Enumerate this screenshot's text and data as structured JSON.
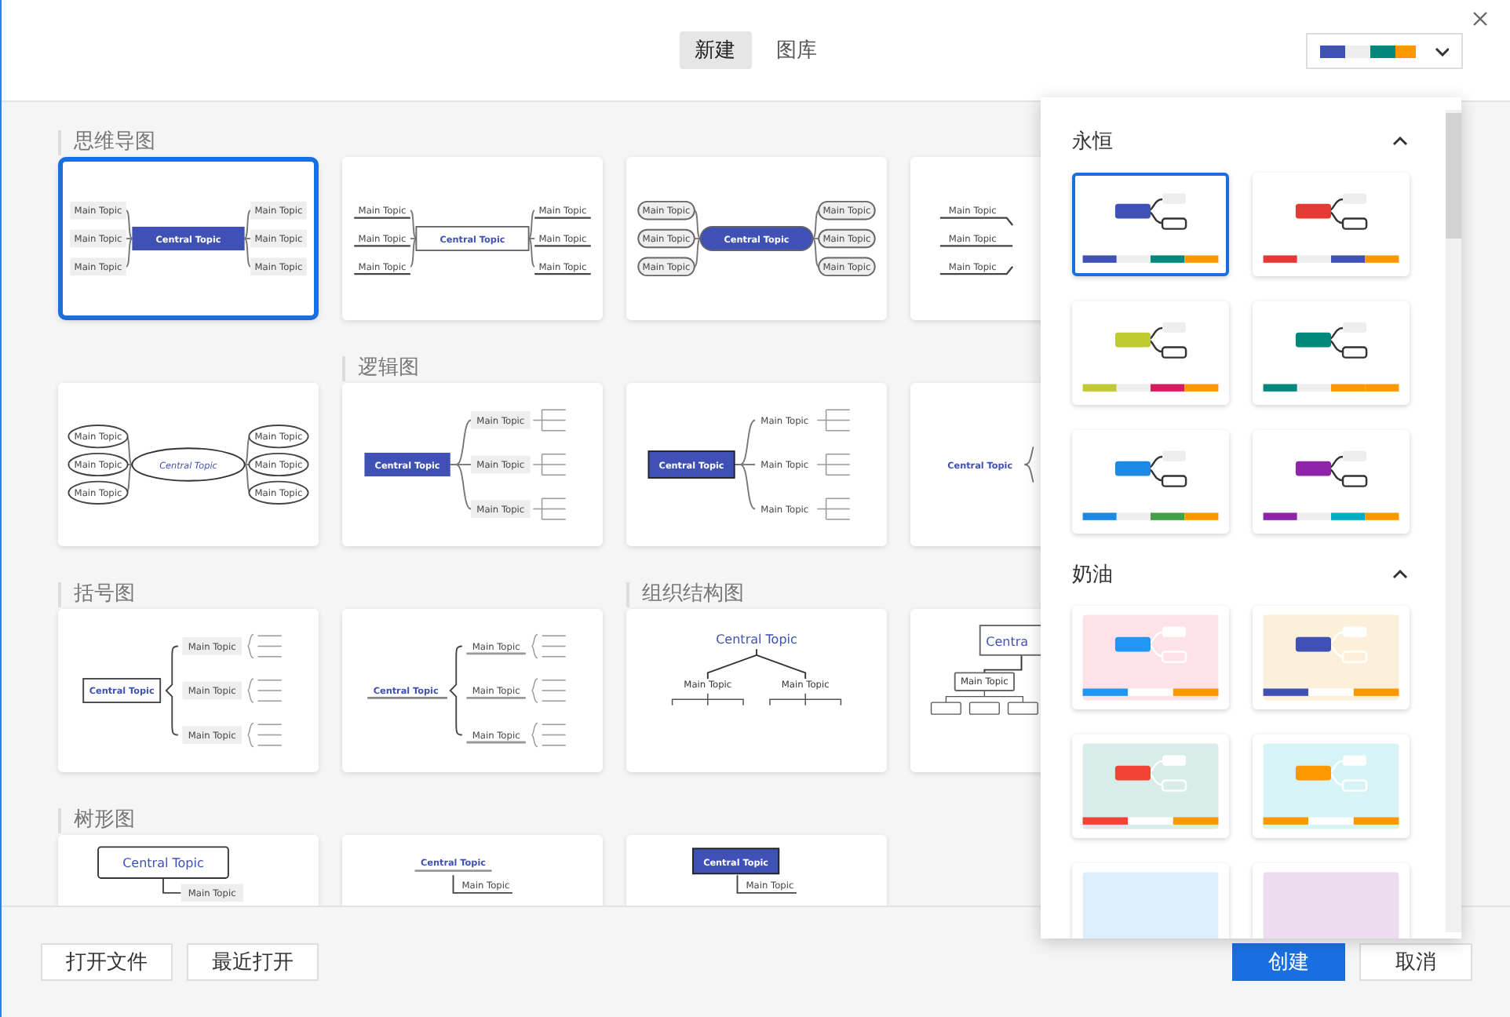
{
  "header": {
    "tabs": [
      {
        "label": "新建",
        "selected": true
      },
      {
        "label": "图库",
        "selected": false
      }
    ],
    "theme_button": {
      "palette": [
        {
          "color": "#3f51b5"
        },
        {
          "color": "#eeeeee"
        },
        {
          "color": "#00897b"
        },
        {
          "color": "#ff9800"
        }
      ]
    }
  },
  "templates": [
    {
      "section": "思维导图",
      "kind": "map",
      "selected": true,
      "center": "Central Topic",
      "topics": [
        "Main Topic",
        "Main Topic",
        "Main Topic",
        "Main Topic",
        "Main Topic",
        "Main Topic"
      ]
    },
    {
      "kind": "map",
      "selected": false,
      "center": "Central Topic",
      "topics": [
        "Main Topic",
        "Main Topic",
        "Main Topic",
        "Main Topic",
        "Main Topic",
        "Main Topic"
      ]
    },
    {
      "kind": "map",
      "selected": false,
      "center": "Central Topic",
      "topics": [
        "Main Topic",
        "Main Topic",
        "Main Topic",
        "Main Topic",
        "Main Topic",
        "Main Topic"
      ]
    },
    {
      "kind": "fishbone",
      "selected": false,
      "topics": [
        "Main Topic",
        "Main Topic",
        "Main Topic"
      ]
    },
    {
      "kind": "map",
      "selected": false,
      "center": "Central Topic",
      "topics": [
        "Main Topic",
        "Main Topic",
        "Main Topic",
        "Main Topic",
        "Main Topic",
        "Main Topic"
      ]
    },
    {
      "section": "逻辑图",
      "kind": "logic",
      "selected": false,
      "center": "Central Topic",
      "topics": [
        "Main Topic",
        "Main Topic",
        "Main Topic"
      ]
    },
    {
      "kind": "logic",
      "selected": false,
      "center": "Central Topic",
      "topics": [
        "Main Topic",
        "Main Topic",
        "Main Topic"
      ]
    },
    {
      "kind": "logic",
      "selected": false,
      "center": "Central Topic"
    },
    {
      "section": "括号图",
      "kind": "bracket",
      "selected": false,
      "center": "Central Topic",
      "topics": [
        "Main Topic",
        "Main Topic",
        "Main Topic"
      ]
    },
    {
      "kind": "bracket",
      "selected": false,
      "center": "Central Topic",
      "topics": [
        "Main Topic",
        "Main Topic",
        "Main Topic"
      ]
    },
    {
      "section": "组织结构图",
      "kind": "org",
      "selected": false,
      "center": "Central Topic",
      "topics": [
        "Main Topic",
        "Main Topic"
      ]
    },
    {
      "kind": "org",
      "selected": false,
      "center": "Centra",
      "topics": [
        "Main Topic"
      ]
    },
    {
      "section": "树形图",
      "kind": "tree",
      "selected": false,
      "center": "Central Topic",
      "topics": [
        "Main Topic"
      ]
    },
    {
      "kind": "tree",
      "selected": false,
      "center": "Central Topic",
      "topics": [
        "Main Topic"
      ]
    },
    {
      "kind": "tree",
      "selected": false,
      "center": "Central Topic",
      "topics": [
        "Main Topic"
      ]
    }
  ],
  "theme_panel": {
    "groups": [
      {
        "title": "永恒",
        "expanded": true,
        "themes": [
          {
            "color": "#3f51b5",
            "palette": [
              {
                "color": "#3f51b5"
              },
              {
                "color": "#eeeeee"
              },
              {
                "color": "#00897b"
              },
              {
                "color": "#ff9800"
              }
            ],
            "selected": true
          },
          {
            "color": "#e53935",
            "palette": [
              {
                "color": "#e53935"
              },
              {
                "color": "#eeeeee"
              },
              {
                "color": "#3f51b5"
              },
              {
                "color": "#ff9800"
              }
            ],
            "selected": false
          },
          {
            "color": "#c0ca33",
            "palette": [
              {
                "color": "#c0ca33"
              },
              {
                "color": "#eeeeee"
              },
              {
                "color": "#d81b60"
              },
              {
                "color": "#ff9800"
              }
            ],
            "selected": false
          },
          {
            "color": "#00897b",
            "palette": [
              {
                "color": "#00897b"
              },
              {
                "color": "#eeeeee"
              },
              {
                "color": "#ff9800"
              },
              {
                "color": "#ff9800"
              }
            ],
            "selected": false
          },
          {
            "color": "#1e88e5",
            "palette": [
              {
                "color": "#1e88e5"
              },
              {
                "color": "#eeeeee"
              },
              {
                "color": "#43a047"
              },
              {
                "color": "#ff9800"
              }
            ],
            "selected": false
          },
          {
            "color": "#8e24aa",
            "palette": [
              {
                "color": "#8e24aa"
              },
              {
                "color": "#eeeeee"
              },
              {
                "color": "#00acc1"
              },
              {
                "color": "#ff9800"
              }
            ],
            "selected": false
          }
        ]
      },
      {
        "title": "奶油",
        "expanded": true,
        "themes": [
          {
            "color": "#2196f3",
            "background": {
              "color": "#fde3e8"
            },
            "palette": [
              {
                "color": "#2196f3"
              },
              {
                "color": "#ffffff"
              },
              {
                "color": "#ff9800"
              }
            ],
            "selected": false
          },
          {
            "color": "#3f51b5",
            "background": {
              "color": "#fdf0da"
            },
            "palette": [
              {
                "color": "#3f51b5"
              },
              {
                "color": "#ffffff"
              },
              {
                "color": "#ff9800"
              }
            ],
            "selected": false
          },
          {
            "color": "#f44336",
            "background": {
              "color": "#d8ecea"
            },
            "palette": [
              {
                "color": "#f44336"
              },
              {
                "color": "#ffffff"
              },
              {
                "color": "#ff9800"
              }
            ],
            "selected": false
          },
          {
            "color": "#ff9800",
            "background": {
              "color": "#d6f3f5"
            },
            "palette": [
              {
                "color": "#ff9800"
              },
              {
                "color": "#ffffff"
              },
              {
                "color": "#ff9800"
              }
            ],
            "selected": false
          },
          {
            "background": {
              "color": "#dceefb"
            },
            "selected": false
          },
          {
            "background": {
              "color": "#eddcf0"
            },
            "selected": false
          }
        ]
      }
    ]
  },
  "footer": {
    "left_buttons": [
      "打开文件",
      "最近打开"
    ],
    "primary_button": "创建",
    "cancel_button": "取消"
  }
}
